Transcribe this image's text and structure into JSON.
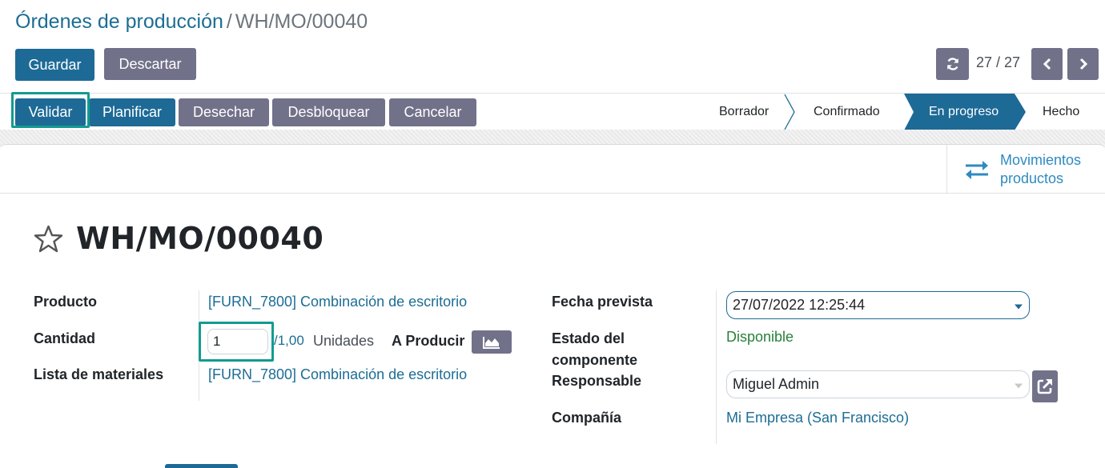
{
  "breadcrumb": {
    "parent": "Órdenes de producción",
    "separator": "/",
    "current": "WH/MO/00040"
  },
  "toolbar": {
    "save_label": "Guardar",
    "discard_label": "Descartar"
  },
  "pager": {
    "count": "27 / 27",
    "refresh_icon": "refresh-icon",
    "prev_icon": "chevron-left-icon",
    "next_icon": "chevron-right-icon"
  },
  "actions": {
    "validate": "Validar",
    "plan": "Planificar",
    "scrap": "Desechar",
    "unlock": "Desbloquear",
    "cancel": "Cancelar"
  },
  "stages": {
    "items": [
      "Borrador",
      "Confirmado",
      "En progreso",
      "Hecho"
    ],
    "active": "En progreso"
  },
  "smart_button": {
    "line1": "Movimientos",
    "line2": "productos",
    "icon": "exchange-arrows-icon"
  },
  "record": {
    "title": "WH/MO/00040",
    "favorite_icon": "star-outline-icon"
  },
  "fields_left": {
    "product_label": "Producto",
    "product_value": "[FURN_7800] Combinación de escritorio",
    "quantity_label": "Cantidad",
    "quantity_value": "1",
    "quantity_target": "/1,00",
    "quantity_uom": "Unidades",
    "to_produce": "A Producir",
    "forecast_icon": "area-chart-icon",
    "bom_label": "Lista de materiales",
    "bom_value": "[FURN_7800] Combinación de escritorio"
  },
  "fields_right": {
    "date_label": "Fecha prevista",
    "date_value": "27/07/2022 12:25:44",
    "component_status_label_1": "Estado del",
    "component_status_label_2": "componente",
    "component_status_value": "Disponible",
    "responsible_label": "Responsable",
    "responsible_value": "Miguel Admin",
    "external_link_icon": "external-link-icon",
    "company_label": "Compañía",
    "company_value": "Mi Empresa (San Francisco)"
  },
  "colors": {
    "primary": "#1d6a96",
    "secondary": "#72718a",
    "link": "#1c6d94",
    "success": "#28803b",
    "highlight": "#139b91"
  }
}
